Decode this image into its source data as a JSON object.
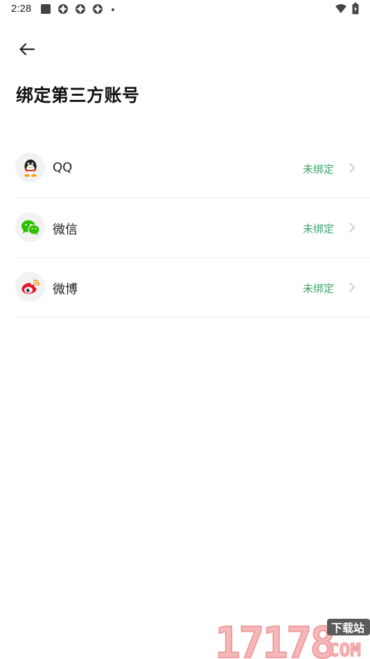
{
  "status_bar": {
    "time": "2:28"
  },
  "header": {
    "back_icon": "arrow-left-icon",
    "title": "绑定第三方账号"
  },
  "accounts": [
    {
      "name": "QQ",
      "status": "未绑定",
      "icon": "qq-icon"
    },
    {
      "name": "微信",
      "status": "未绑定",
      "icon": "wechat-icon"
    },
    {
      "name": "微博",
      "status": "未绑定",
      "icon": "weibo-icon"
    }
  ],
  "watermark": {
    "number": "17178",
    "tag": "下载站",
    "domain": "COM"
  },
  "colors": {
    "status_green": "#3fa36d",
    "divider": "#ececec",
    "icon_bg": "#f2f2f2"
  }
}
